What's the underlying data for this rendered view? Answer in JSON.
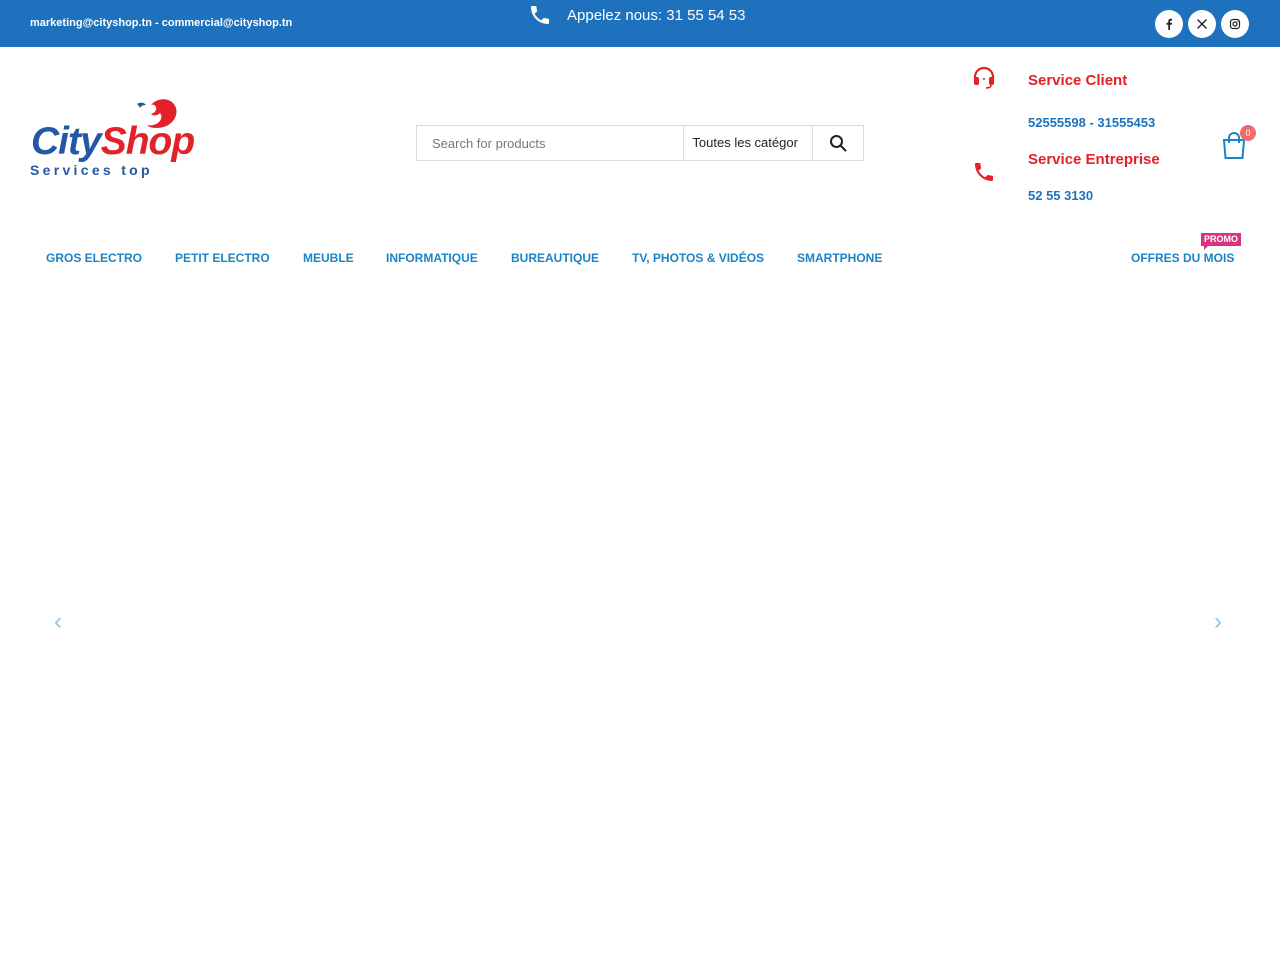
{
  "topbar": {
    "emails": "marketing@cityshop.tn - commercial@cityshop.tn",
    "phone_text": "Appelez nous: 31 55 54 53",
    "background": "#1e72bd",
    "social": [
      {
        "icon": "facebook-icon"
      },
      {
        "icon": "x-icon"
      },
      {
        "icon": "instagram-icon"
      }
    ]
  },
  "logo": {
    "city": "City",
    "shop": "Shop",
    "tagline": "Services top"
  },
  "search": {
    "placeholder": "Search for products",
    "category": "Toutes les catégor"
  },
  "service_client": {
    "title": "Service Client",
    "numbers": "52555598 - 31555453"
  },
  "service_entreprise": {
    "title": "Service Entreprise",
    "numbers": "52 55 3130"
  },
  "cart": {
    "count": "0"
  },
  "nav": {
    "items": [
      {
        "label": "GROS ELECTRO"
      },
      {
        "label": "PETIT ELECTRO"
      },
      {
        "label": "MEUBLE"
      },
      {
        "label": "INFORMATIQUE"
      },
      {
        "label": "BUREAUTIQUE"
      },
      {
        "label": "TV, PHOTOS & VIDÉOS"
      },
      {
        "label": "SMARTPHONE"
      }
    ],
    "offers": "OFFRES DU MOIS",
    "promo_badge": "PROMO"
  },
  "slider": {
    "prev": "‹",
    "next": "›"
  },
  "colors": {
    "brand_blue": "#1e72bd",
    "brand_red": "#e32129",
    "menu_blue": "#1a84c7",
    "promo_pink": "#d8347b"
  }
}
